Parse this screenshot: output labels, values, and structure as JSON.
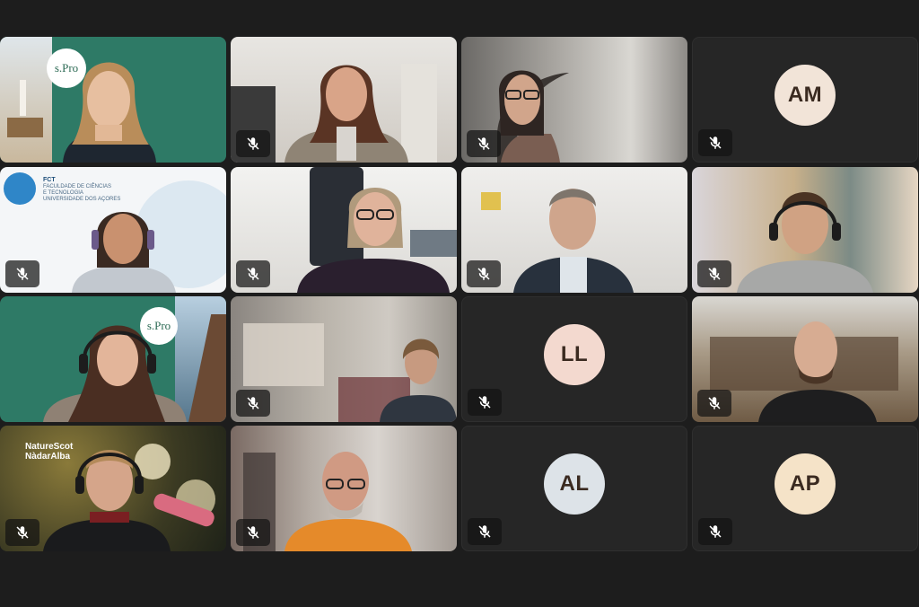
{
  "participants": [
    {
      "id": "p1",
      "muted": true
    },
    {
      "id": "p2",
      "muted": true
    },
    {
      "id": "p3",
      "muted": true
    },
    {
      "id": "p4",
      "initials": "AM",
      "avatar_color": "#f2e4d8",
      "muted": true
    },
    {
      "id": "p5",
      "muted": true
    },
    {
      "id": "p6",
      "muted": true
    },
    {
      "id": "p7",
      "muted": true
    },
    {
      "id": "p8",
      "muted": true
    },
    {
      "id": "p9",
      "muted": true
    },
    {
      "id": "p10",
      "muted": true
    },
    {
      "id": "p11",
      "initials": "LL",
      "avatar_color": "#f3d9cf",
      "muted": true
    },
    {
      "id": "p12",
      "muted": true
    },
    {
      "id": "p13",
      "muted": true
    },
    {
      "id": "p14",
      "muted": true
    },
    {
      "id": "p15",
      "initials": "AL",
      "avatar_color": "#dde3e8",
      "muted": true
    },
    {
      "id": "p16",
      "initials": "AP",
      "avatar_color": "#f5e3c8",
      "muted": true
    }
  ],
  "backgrounds": {
    "spro_logo": "s.Pro",
    "fct_title": "FCT",
    "fct_line1": "FACULDADE DE CIÊNCIAS",
    "fct_line2": "E TECNOLOGIA",
    "fct_line3": "UNIVERSIDADE DOS AÇORES",
    "naturescot_line1": "NatureScot",
    "naturescot_line2": "NàdarAlba"
  },
  "icons": {
    "mic_muted": "microphone-slash-icon"
  }
}
